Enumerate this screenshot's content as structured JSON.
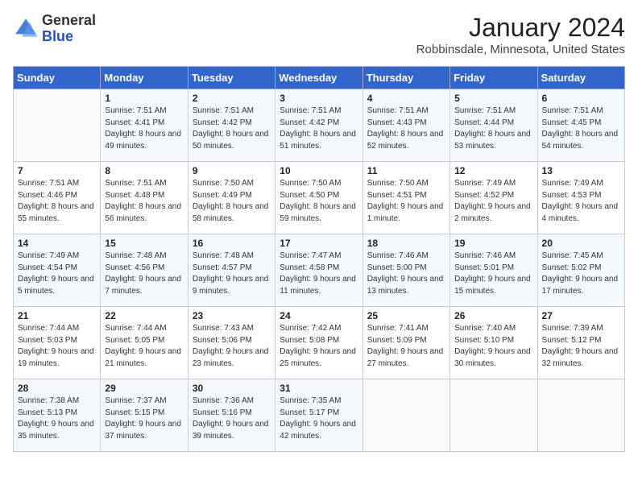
{
  "header": {
    "logo": {
      "general": "General",
      "blue": "Blue"
    },
    "title": "January 2024",
    "location": "Robbinsdale, Minnesota, United States"
  },
  "days_of_week": [
    "Sunday",
    "Monday",
    "Tuesday",
    "Wednesday",
    "Thursday",
    "Friday",
    "Saturday"
  ],
  "weeks": [
    [
      {
        "day": "",
        "sunrise": "",
        "sunset": "",
        "daylight": ""
      },
      {
        "day": "1",
        "sunrise": "7:51 AM",
        "sunset": "4:41 PM",
        "daylight": "8 hours and 49 minutes."
      },
      {
        "day": "2",
        "sunrise": "7:51 AM",
        "sunset": "4:42 PM",
        "daylight": "8 hours and 50 minutes."
      },
      {
        "day": "3",
        "sunrise": "7:51 AM",
        "sunset": "4:42 PM",
        "daylight": "8 hours and 51 minutes."
      },
      {
        "day": "4",
        "sunrise": "7:51 AM",
        "sunset": "4:43 PM",
        "daylight": "8 hours and 52 minutes."
      },
      {
        "day": "5",
        "sunrise": "7:51 AM",
        "sunset": "4:44 PM",
        "daylight": "8 hours and 53 minutes."
      },
      {
        "day": "6",
        "sunrise": "7:51 AM",
        "sunset": "4:45 PM",
        "daylight": "8 hours and 54 minutes."
      }
    ],
    [
      {
        "day": "7",
        "sunrise": "7:51 AM",
        "sunset": "4:46 PM",
        "daylight": "8 hours and 55 minutes."
      },
      {
        "day": "8",
        "sunrise": "7:51 AM",
        "sunset": "4:48 PM",
        "daylight": "8 hours and 56 minutes."
      },
      {
        "day": "9",
        "sunrise": "7:50 AM",
        "sunset": "4:49 PM",
        "daylight": "8 hours and 58 minutes."
      },
      {
        "day": "10",
        "sunrise": "7:50 AM",
        "sunset": "4:50 PM",
        "daylight": "8 hours and 59 minutes."
      },
      {
        "day": "11",
        "sunrise": "7:50 AM",
        "sunset": "4:51 PM",
        "daylight": "9 hours and 1 minute."
      },
      {
        "day": "12",
        "sunrise": "7:49 AM",
        "sunset": "4:52 PM",
        "daylight": "9 hours and 2 minutes."
      },
      {
        "day": "13",
        "sunrise": "7:49 AM",
        "sunset": "4:53 PM",
        "daylight": "9 hours and 4 minutes."
      }
    ],
    [
      {
        "day": "14",
        "sunrise": "7:49 AM",
        "sunset": "4:54 PM",
        "daylight": "9 hours and 5 minutes."
      },
      {
        "day": "15",
        "sunrise": "7:48 AM",
        "sunset": "4:56 PM",
        "daylight": "9 hours and 7 minutes."
      },
      {
        "day": "16",
        "sunrise": "7:48 AM",
        "sunset": "4:57 PM",
        "daylight": "9 hours and 9 minutes."
      },
      {
        "day": "17",
        "sunrise": "7:47 AM",
        "sunset": "4:58 PM",
        "daylight": "9 hours and 11 minutes."
      },
      {
        "day": "18",
        "sunrise": "7:46 AM",
        "sunset": "5:00 PM",
        "daylight": "9 hours and 13 minutes."
      },
      {
        "day": "19",
        "sunrise": "7:46 AM",
        "sunset": "5:01 PM",
        "daylight": "9 hours and 15 minutes."
      },
      {
        "day": "20",
        "sunrise": "7:45 AM",
        "sunset": "5:02 PM",
        "daylight": "9 hours and 17 minutes."
      }
    ],
    [
      {
        "day": "21",
        "sunrise": "7:44 AM",
        "sunset": "5:03 PM",
        "daylight": "9 hours and 19 minutes."
      },
      {
        "day": "22",
        "sunrise": "7:44 AM",
        "sunset": "5:05 PM",
        "daylight": "9 hours and 21 minutes."
      },
      {
        "day": "23",
        "sunrise": "7:43 AM",
        "sunset": "5:06 PM",
        "daylight": "9 hours and 23 minutes."
      },
      {
        "day": "24",
        "sunrise": "7:42 AM",
        "sunset": "5:08 PM",
        "daylight": "9 hours and 25 minutes."
      },
      {
        "day": "25",
        "sunrise": "7:41 AM",
        "sunset": "5:09 PM",
        "daylight": "9 hours and 27 minutes."
      },
      {
        "day": "26",
        "sunrise": "7:40 AM",
        "sunset": "5:10 PM",
        "daylight": "9 hours and 30 minutes."
      },
      {
        "day": "27",
        "sunrise": "7:39 AM",
        "sunset": "5:12 PM",
        "daylight": "9 hours and 32 minutes."
      }
    ],
    [
      {
        "day": "28",
        "sunrise": "7:38 AM",
        "sunset": "5:13 PM",
        "daylight": "9 hours and 35 minutes."
      },
      {
        "day": "29",
        "sunrise": "7:37 AM",
        "sunset": "5:15 PM",
        "daylight": "9 hours and 37 minutes."
      },
      {
        "day": "30",
        "sunrise": "7:36 AM",
        "sunset": "5:16 PM",
        "daylight": "9 hours and 39 minutes."
      },
      {
        "day": "31",
        "sunrise": "7:35 AM",
        "sunset": "5:17 PM",
        "daylight": "9 hours and 42 minutes."
      },
      {
        "day": "",
        "sunrise": "",
        "sunset": "",
        "daylight": ""
      },
      {
        "day": "",
        "sunrise": "",
        "sunset": "",
        "daylight": ""
      },
      {
        "day": "",
        "sunrise": "",
        "sunset": "",
        "daylight": ""
      }
    ]
  ]
}
